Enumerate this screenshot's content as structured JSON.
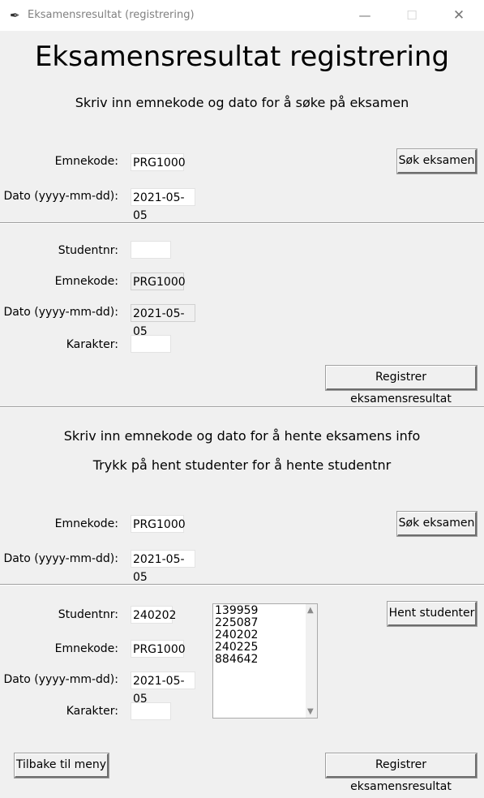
{
  "window": {
    "title": "Eksamensresultat (registrering)",
    "minimize_glyph": "—",
    "maximize_glyph": "☐",
    "close_glyph": "✕",
    "app_icon": "feather-icon"
  },
  "main_title": "Eksamensresultat registrering",
  "search_section": {
    "instruction": "Skriv inn emnekode og dato for å søke på eksamen",
    "emnekode_label": "Emnekode:",
    "emnekode_value": "PRG1000",
    "dato_label": "Dato (yyyy-mm-dd):",
    "dato_value": "2021-05-05",
    "search_button": "Søk eksamen"
  },
  "register_section": {
    "studentnr_label": "Studentnr:",
    "studentnr_value": "",
    "emnekode_label": "Emnekode:",
    "emnekode_value": "PRG1000",
    "dato_label": "Dato (yyyy-mm-dd):",
    "dato_value": "2021-05-05",
    "karakter_label": "Karakter:",
    "karakter_value": "",
    "register_button": "Registrer eksamensresultat"
  },
  "fetch_section": {
    "instruction_1": "Skriv inn emnekode og dato for å hente eksamens info",
    "instruction_2": "Trykk på hent studenter for å hente studentnr",
    "emnekode_label": "Emnekode:",
    "emnekode_value": "PRG1000",
    "dato_label": "Dato (yyyy-mm-dd):",
    "dato_value": "2021-05-05",
    "search_button": "Søk eksamen"
  },
  "student_section": {
    "studentnr_label": "Studentnr:",
    "studentnr_value": "240202",
    "emnekode_label": "Emnekode:",
    "emnekode_value": "PRG1000",
    "dato_label": "Dato (yyyy-mm-dd):",
    "dato_value": "2021-05-05",
    "karakter_label": "Karakter:",
    "karakter_value": "",
    "students": [
      "139959",
      "225087",
      "240202",
      "240225",
      "884642"
    ],
    "fetch_button": "Hent studenter",
    "back_button": "Tilbake til meny",
    "register_button": "Registrer eksamensresultat"
  }
}
